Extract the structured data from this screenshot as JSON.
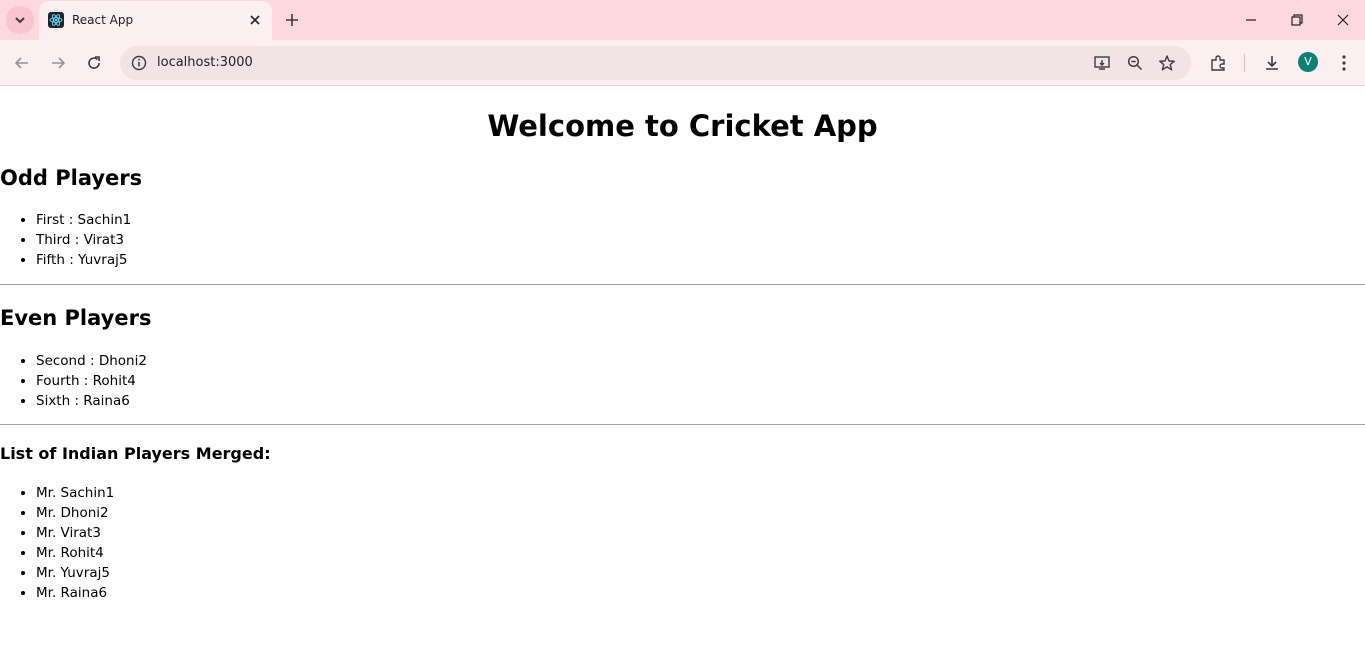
{
  "browser": {
    "tab_title": "React App",
    "url": "localhost:3000",
    "profile_initial": "V"
  },
  "page": {
    "title": "Welcome to Cricket App",
    "odd_heading": "Odd Players",
    "odd_players": [
      "First : Sachin1",
      "Third : Virat3",
      "Fifth : Yuvraj5"
    ],
    "even_heading": "Even Players",
    "even_players": [
      "Second : Dhoni2",
      "Fourth : Rohit4",
      "Sixth : Raina6"
    ],
    "merged_heading": "List of Indian Players Merged:",
    "merged_players": [
      "Mr. Sachin1",
      "Mr. Dhoni2",
      "Mr. Virat3",
      "Mr. Rohit4",
      "Mr. Yuvraj5",
      "Mr. Raina6"
    ]
  },
  "colors": {
    "tabstrip": "#fdd8df",
    "toolbar": "#fbeff2",
    "avatar": "#0f8074"
  }
}
